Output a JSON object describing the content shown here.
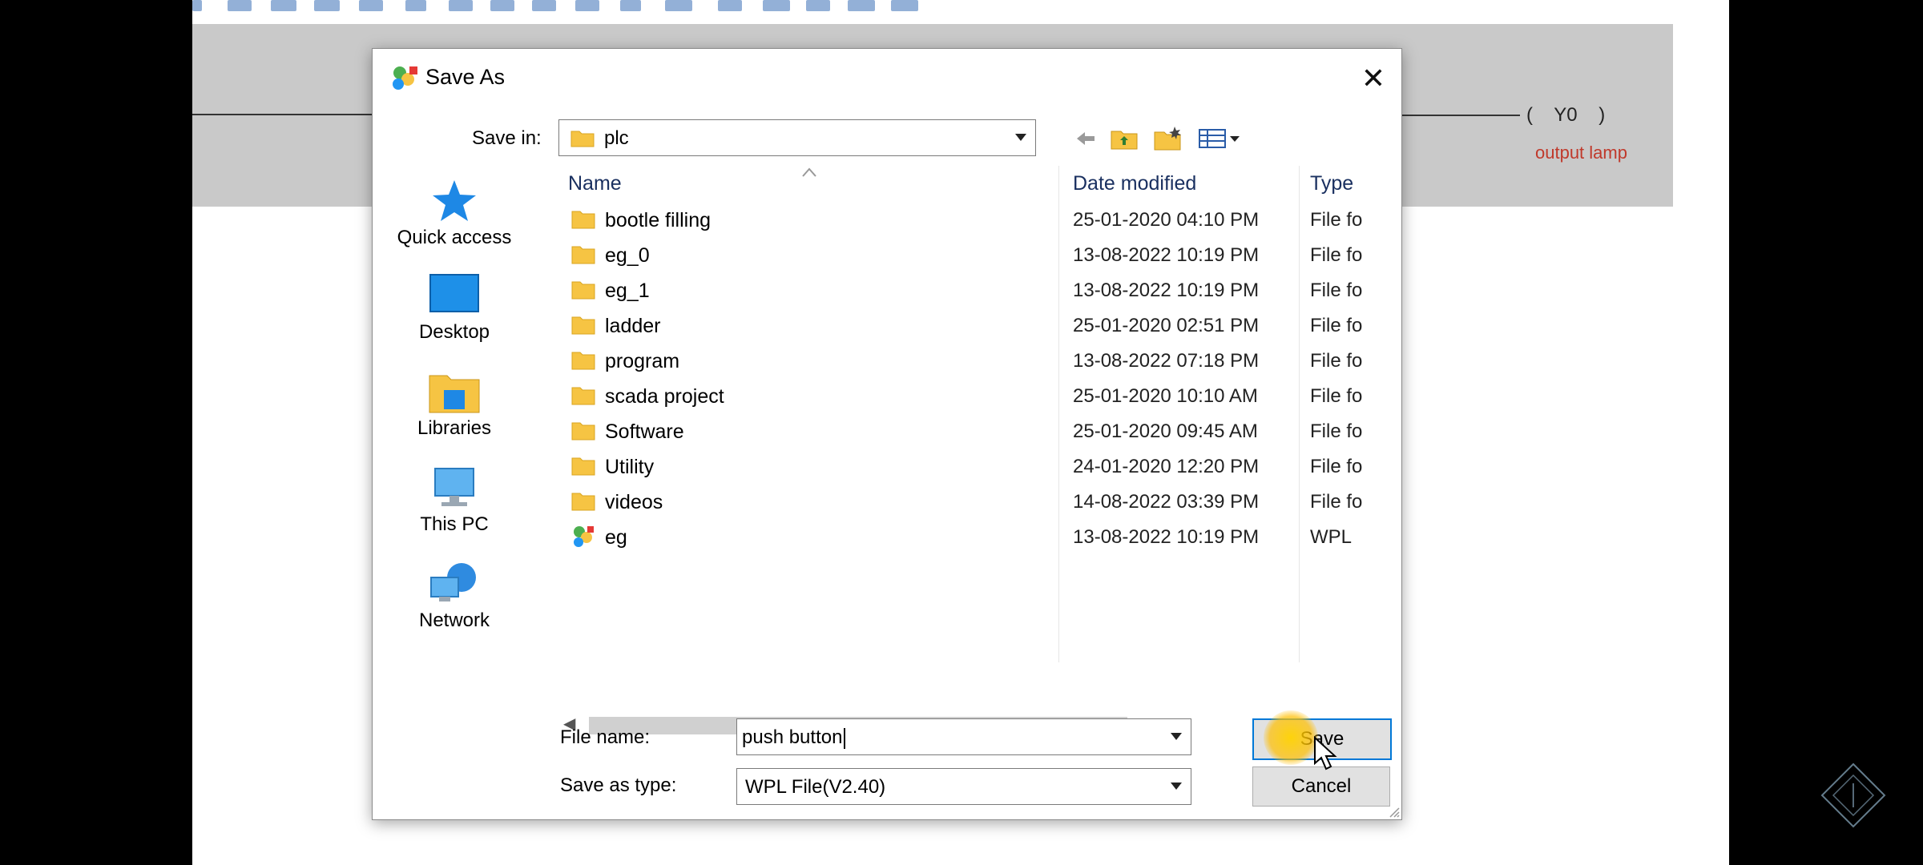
{
  "background": {
    "coil_label": "(    Y0    )",
    "coil_comment": "output lamp",
    "colors": {
      "ladder_bg": "#c9c9c9",
      "comment_red": "#c0392b"
    }
  },
  "dialog": {
    "title": "Save As",
    "close_glyph": "✕",
    "save_in_label": "Save in:",
    "save_in_value": "plc",
    "places": [
      {
        "label": "Quick access",
        "icon": "star-icon"
      },
      {
        "label": "Desktop",
        "icon": "desktop-icon"
      },
      {
        "label": "Libraries",
        "icon": "libraries-icon"
      },
      {
        "label": "This PC",
        "icon": "computer-icon"
      },
      {
        "label": "Network",
        "icon": "network-icon"
      }
    ],
    "columns": {
      "name": "Name",
      "date": "Date modified",
      "type": "Type"
    },
    "files": [
      {
        "name": "bootle filling",
        "date": "25-01-2020 04:10 PM",
        "type": "File fo",
        "kind": "folder"
      },
      {
        "name": "eg_0",
        "date": "13-08-2022 10:19 PM",
        "type": "File fo",
        "kind": "folder"
      },
      {
        "name": "eg_1",
        "date": "13-08-2022 10:19 PM",
        "type": "File fo",
        "kind": "folder"
      },
      {
        "name": "ladder",
        "date": "25-01-2020 02:51 PM",
        "type": "File fo",
        "kind": "folder"
      },
      {
        "name": "program",
        "date": "13-08-2022 07:18 PM",
        "type": "File fo",
        "kind": "folder"
      },
      {
        "name": "scada project",
        "date": "25-01-2020 10:10 AM",
        "type": "File fo",
        "kind": "folder"
      },
      {
        "name": "Software",
        "date": "25-01-2020 09:45 AM",
        "type": "File fo",
        "kind": "folder"
      },
      {
        "name": "Utility",
        "date": "24-01-2020 12:20 PM",
        "type": "File fo",
        "kind": "folder"
      },
      {
        "name": "videos",
        "date": "14-08-2022 03:39 PM",
        "type": "File fo",
        "kind": "folder"
      },
      {
        "name": "eg",
        "date": "13-08-2022 10:19 PM",
        "type": "WPL",
        "kind": "wpl"
      }
    ],
    "file_name_label": "File name:",
    "file_name_value": "push button",
    "save_as_type_label": "Save as type:",
    "save_as_type_value": "WPL File(V2.40)",
    "save_button": "Save",
    "cancel_button": "Cancel",
    "colors": {
      "accent": "#0078d7",
      "folder": "#f6c443",
      "header_text": "#1a3060"
    }
  }
}
